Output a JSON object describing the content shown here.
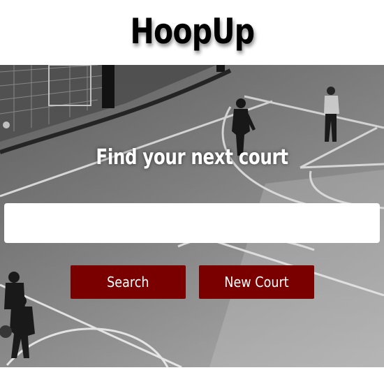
{
  "app": {
    "title": "HoopUp"
  },
  "hero": {
    "headline": "Find your next court",
    "background": "black-and-white photo of people playing on an outdoor basketball court"
  },
  "search": {
    "value": "",
    "placeholder": ""
  },
  "actions": {
    "search_label": "Search",
    "new_court_label": "New Court"
  },
  "colors": {
    "button_bg": "#7a0000",
    "button_text": "#ffffff",
    "title_text": "#000000",
    "headline_text": "#ffffff"
  }
}
